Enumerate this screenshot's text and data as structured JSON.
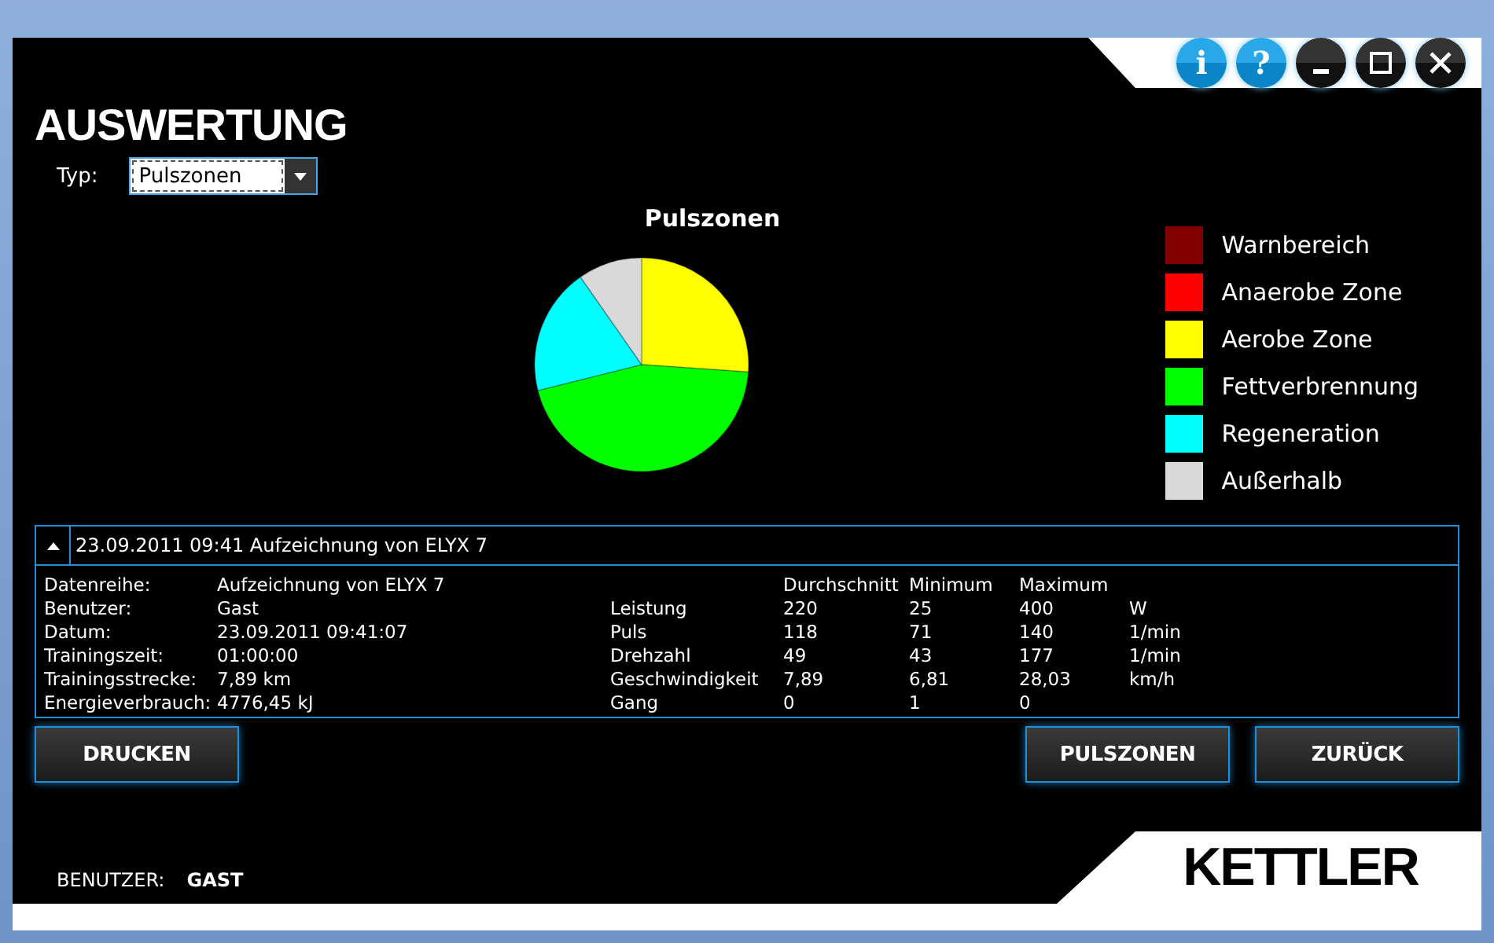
{
  "window_controls": [
    {
      "kind": "info",
      "label": "i"
    },
    {
      "kind": "help",
      "label": "?"
    },
    {
      "kind": "minimize"
    },
    {
      "kind": "maximize"
    },
    {
      "kind": "close"
    }
  ],
  "title": "AUSWERTUNG",
  "type_select": {
    "label": "Typ:",
    "value": "Pulszonen"
  },
  "chart": {
    "chart_data": {
      "type": "pie",
      "title": "Pulszonen",
      "categories": [
        "Warnbereich",
        "Anaerobe Zone",
        "Aerobe Zone",
        "Fettverbrennung",
        "Regeneration",
        "Außerhalb"
      ],
      "series": [
        {
          "values": [
            0,
            0,
            26.1,
            45.0,
            19.2,
            9.7
          ]
        }
      ]
    }
  },
  "legend": [
    {
      "color": "#800000"
    },
    {
      "color": "#ff0000"
    },
    {
      "color": "#ffff00"
    },
    {
      "color": "#00ff00"
    },
    {
      "color": "#00ffff"
    },
    {
      "color": "#d9d9d9"
    }
  ],
  "details": {
    "header": "23.09.2011 09:41 Aufzeichnung von ELYX 7",
    "expanded": true,
    "info": [
      {
        "label": "Datenreihe:",
        "value": "Aufzeichnung von ELYX 7"
      },
      {
        "label": "Benutzer:",
        "value": "Gast"
      },
      {
        "label": "Datum:",
        "value": "23.09.2011 09:41:07"
      },
      {
        "label": "Trainingszeit:",
        "value": "01:00:00"
      },
      {
        "label": "Trainingsstrecke:",
        "value": "7,89 km"
      },
      {
        "label": "Energieverbrauch:",
        "value": "4776,45 kJ"
      }
    ],
    "stats": {
      "columns": [
        "Durchschnitt",
        "Minimum",
        "Maximum"
      ],
      "rows": [
        {
          "name": "Leistung",
          "values": [
            "220",
            "25",
            "400"
          ],
          "unit": "W"
        },
        {
          "name": "Puls",
          "values": [
            "118",
            "71",
            "140"
          ],
          "unit": "1/min"
        },
        {
          "name": "Drehzahl",
          "values": [
            "49",
            "43",
            "177"
          ],
          "unit": "1/min"
        },
        {
          "name": "Geschwindigkeit",
          "values": [
            "7,89",
            "6,81",
            "28,03"
          ],
          "unit": "km/h"
        },
        {
          "name": "Gang",
          "values": [
            "0",
            "1",
            "0"
          ]
        }
      ]
    }
  },
  "buttons_left": [
    "DRUCKEN"
  ],
  "buttons_right": [
    "PULSZONEN",
    "ZURÜCK"
  ],
  "footer": {
    "user_label": "BENUTZER:",
    "user_name": "GAST",
    "logo": "KETTLER"
  }
}
